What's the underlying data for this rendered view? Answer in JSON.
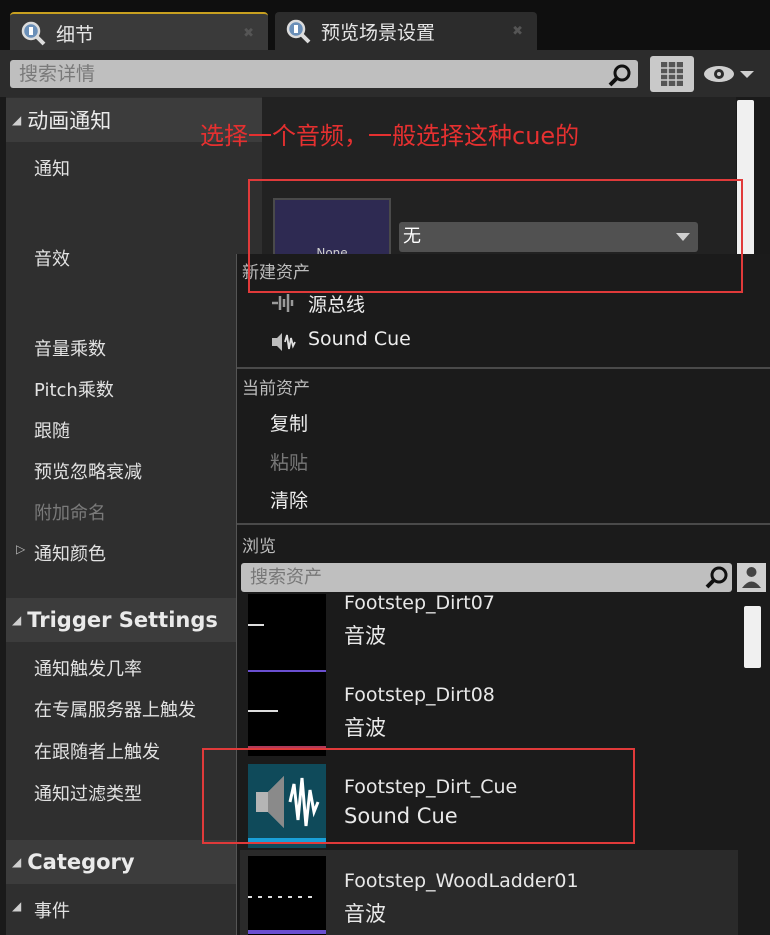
{
  "tabs": [
    {
      "label": "细节",
      "icon": "details-magnifier-icon",
      "active": true
    },
    {
      "label": "预览场景设置",
      "icon": "details-magnifier-icon",
      "active": false
    }
  ],
  "toolbar": {
    "search_placeholder": "搜索详情"
  },
  "categories": {
    "anim_notify": "动画通知",
    "trigger": "Trigger Settings",
    "category": "Category"
  },
  "props": {
    "notify": "通知",
    "sound": "音效",
    "volume": "音量乘数",
    "pitch": "Pitch乘数",
    "follow": "跟随",
    "preview_ignore": "预览忽略衰减",
    "attach_name": "附加命名",
    "notify_color": "通知颜色",
    "trigger_chance": "通知触发几率",
    "dedicated_server": "在专属服务器上触发",
    "follower_trigger": "在跟随者上触发",
    "filter_type": "通知过滤类型",
    "event": "事件"
  },
  "annotation": "选择一个音频，一般选择这种cue的",
  "asset": {
    "thumb_label": "None",
    "combo_value": "无"
  },
  "menu": {
    "new_asset_header": "新建资产",
    "source_bus": "源总线",
    "sound_cue": "Sound Cue",
    "current_asset_header": "当前资产",
    "copy": "复制",
    "paste": "粘贴",
    "clear": "清除",
    "browse_header": "浏览",
    "asset_search_placeholder": "搜索资产"
  },
  "assets": [
    {
      "name": "Footstep_Dirt07",
      "type": "音波",
      "bar_color": "#6a4fd0"
    },
    {
      "name": "Footstep_Dirt08",
      "type": "音波",
      "bar_color": "#b03a5a"
    },
    {
      "name": "Footstep_Dirt_Cue",
      "type": "Sound Cue",
      "bar_color": "#1aa0d8"
    },
    {
      "name": "Footstep_WoodLadder01",
      "type": "音波",
      "bar_color": "#6a4fd0"
    }
  ],
  "colors": {
    "annotation_red": "#e53030",
    "active_tab_accent": "#c8a020"
  }
}
